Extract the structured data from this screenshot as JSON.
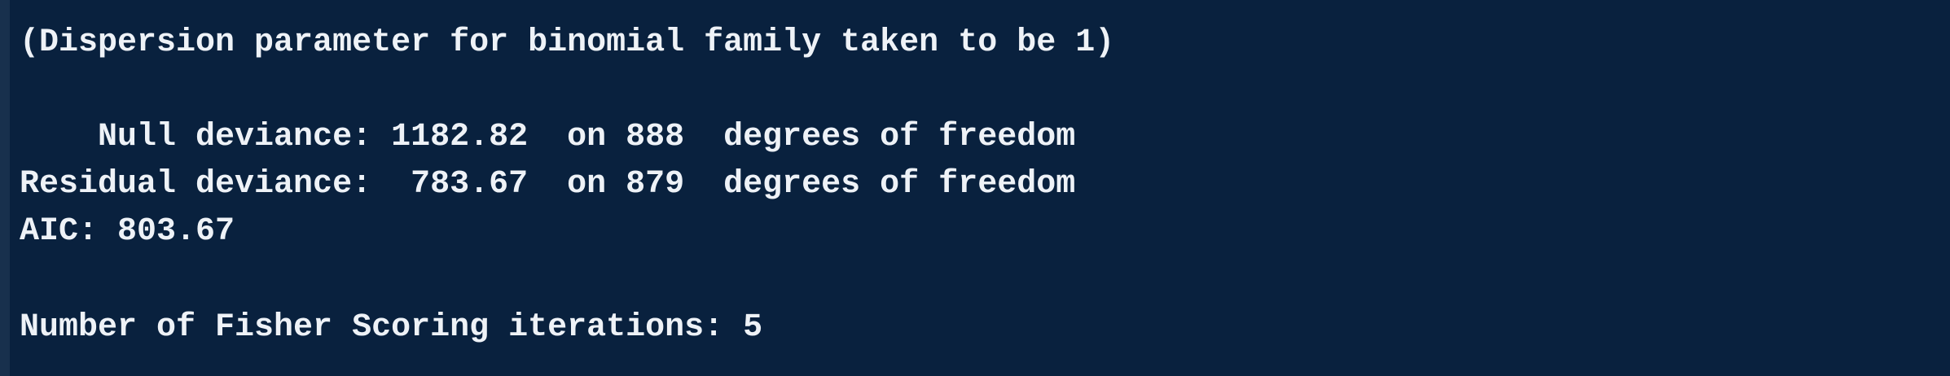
{
  "console": {
    "lines": [
      "(Dispersion parameter for binomial family taken to be 1)",
      "    Null deviance: 1182.82  on 888  degrees of freedom",
      "Residual deviance:  783.67  on 879  degrees of freedom",
      "AIC: 803.67",
      "Number of Fisher Scoring iterations: 5"
    ]
  },
  "colors": {
    "background": "#09213e",
    "text": "#eef2f7",
    "left_border": "#18304d"
  }
}
